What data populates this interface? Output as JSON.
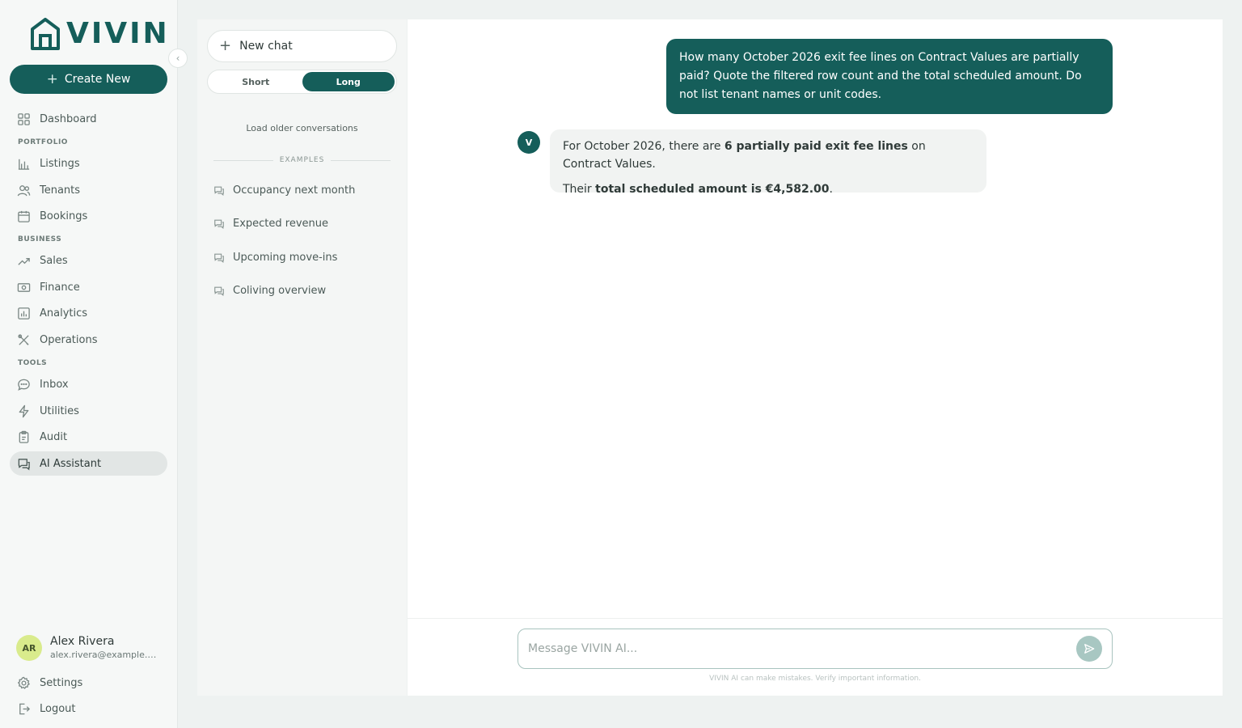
{
  "brand": {
    "name": "VIVIN",
    "accent": "#155e5a"
  },
  "sidebar": {
    "create_label": "Create New",
    "sections": {
      "portfolio": "PORTFOLIO",
      "business": "BUSINESS",
      "tools": "TOOLS"
    },
    "items": {
      "dashboard": "Dashboard",
      "listings": "Listings",
      "tenants": "Tenants",
      "bookings": "Bookings",
      "sales": "Sales",
      "finance": "Finance",
      "analytics": "Analytics",
      "operations": "Operations",
      "inbox": "Inbox",
      "utilities": "Utilities",
      "audit": "Audit",
      "ai_assistant": "AI Assistant"
    },
    "active_item": "ai_assistant",
    "user": {
      "initials": "AR",
      "name": "Alex Rivera",
      "email": "alex.rivera@example.com"
    },
    "settings_label": "Settings",
    "logout_label": "Logout"
  },
  "history": {
    "new_chat_label": "New chat",
    "length_toggle": {
      "short": "Short",
      "long": "Long",
      "selected": "Long"
    },
    "load_older": "Load older conversations",
    "examples_label": "EXAMPLES",
    "examples": [
      "Occupancy next month",
      "Expected revenue",
      "Upcoming move-ins",
      "Coliving overview"
    ]
  },
  "chat": {
    "user_message": "How many October 2026 exit fee lines on Contract Values are partially paid? Quote the filtered row count and the total scheduled amount. Do not list tenant names or unit codes.",
    "bot_initial": "V",
    "bot_reply": {
      "line1_prefix": "For October 2026, there are ",
      "line1_bold": "6 partially paid exit fee lines",
      "line1_suffix": " on Contract Values.",
      "line2_prefix": "Their ",
      "line2_bold": "total scheduled amount is €4,582.00",
      "line2_suffix": "."
    },
    "composer_placeholder": "Message VIVIN AI...",
    "disclaimer": "VIVIN AI can make mistakes. Verify important information."
  }
}
